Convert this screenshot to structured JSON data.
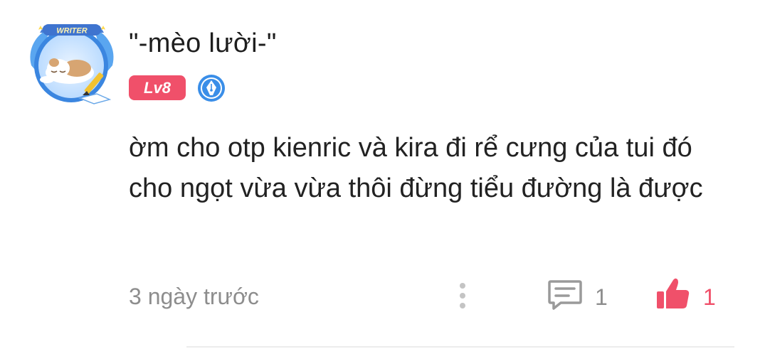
{
  "comment": {
    "author": {
      "name": "\"-mèo lười-\"",
      "avatar_frame_label": "WRITER",
      "level": "Lv8",
      "badge_icon": "pen-nib-icon"
    },
    "text": "ờm cho otp kienric và kira đi rể cưng của tui đó cho ngọt vừa vừa thôi đừng tiểu đường là được",
    "timestamp": "3 ngày trước",
    "actions": {
      "more_icon": "more-vertical-icon",
      "reply_icon": "chat-bubble-icon",
      "reply_count": "1",
      "like_icon": "thumbs-up-icon",
      "like_count": "1"
    },
    "colors": {
      "accent": "#f0506a",
      "muted_text": "#8d8d8d",
      "badge_blue": "#3a8ee8"
    }
  }
}
